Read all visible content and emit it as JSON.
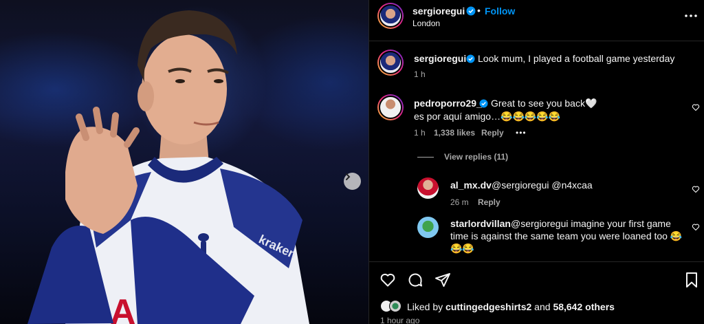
{
  "colors": {
    "background": "#000000",
    "accent": "#0095f6",
    "muted": "#a8a8a8",
    "verified": "#0095f6"
  },
  "post": {
    "username": "sergioregui",
    "follow_label": "Follow",
    "separator": "•",
    "location": "London",
    "more_icon": "more-horizontal-icon"
  },
  "caption": {
    "username": "sergioregui",
    "text": "Look mum, I played a football game yesterday",
    "time": "1 h"
  },
  "comments": [
    {
      "username": "pedroporro29_",
      "verified": true,
      "line1": "Great to see you back🤍",
      "line2": "es por aquí amigo…😂😂😂😂😂",
      "time": "1 h",
      "likes": "1,338 likes",
      "reply_label": "Reply",
      "options_label": "•••",
      "view_replies": "View replies (11)"
    }
  ],
  "replies": [
    {
      "username": "al_mx.dv",
      "text": "@sergioregui @n4xcaa",
      "time": "26 m",
      "reply_label": "Reply"
    },
    {
      "username": "starlordvillan",
      "text_line1": "@sergioregui imagine your first game",
      "text_line2": "time is against the same team you were loaned too 😂",
      "text_line3": "😂😂"
    }
  ],
  "likes": {
    "prefix": "Liked by ",
    "user": "cuttingedgeshirts2",
    "middle": " and ",
    "count": "58,642 others",
    "time": "1 hour ago"
  },
  "icons": {
    "like": "heart-icon",
    "comment": "comment-icon",
    "share": "send-icon",
    "save": "bookmark-icon",
    "next": "chevron-right-icon",
    "verified": "verified-badge-icon"
  }
}
